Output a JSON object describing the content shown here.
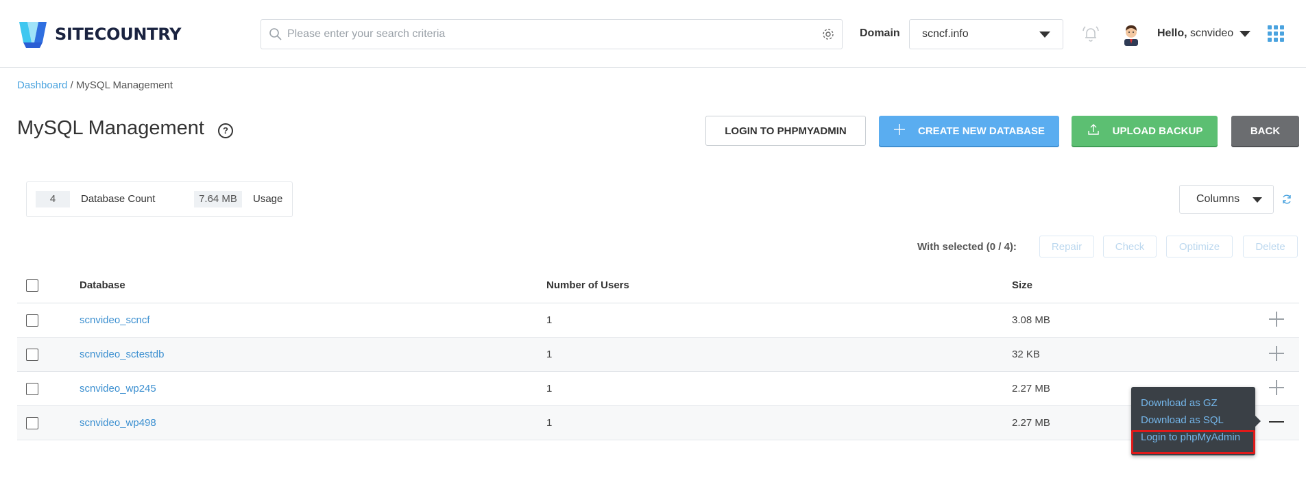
{
  "brand": {
    "name": "SITECOUNTRY",
    "accent": "#4aa3df"
  },
  "search": {
    "placeholder": "Please enter your search criteria"
  },
  "domain": {
    "label": "Domain",
    "selected": "scncf.info"
  },
  "user": {
    "greeting": "Hello,",
    "username": "scnvideo"
  },
  "breadcrumb": {
    "home": "Dashboard",
    "separator": "/",
    "current": "MySQL Management"
  },
  "page": {
    "title": "MySQL Management",
    "help": "?"
  },
  "actions": {
    "phpmyadmin": "LOGIN TO PHPMYADMIN",
    "create": "CREATE NEW DATABASE",
    "upload": "UPLOAD BACKUP",
    "back": "BACK"
  },
  "stats": {
    "count": "4",
    "count_label": "Database Count",
    "usage": "7.64 MB",
    "usage_label": "Usage"
  },
  "columns_button": "Columns",
  "bulk": {
    "label": "With selected (0 / 4):",
    "repair": "Repair",
    "check": "Check",
    "optimize": "Optimize",
    "delete": "Delete"
  },
  "table": {
    "headers": {
      "database": "Database",
      "users": "Number of Users",
      "size": "Size"
    },
    "rows": [
      {
        "database": "scnvideo_scncf",
        "users": "1",
        "size": "3.08 MB"
      },
      {
        "database": "scnvideo_sctestdb",
        "users": "1",
        "size": "32 KB"
      },
      {
        "database": "scnvideo_wp245",
        "users": "1",
        "size": "2.27 MB"
      },
      {
        "database": "scnvideo_wp498",
        "users": "1",
        "size": "2.27 MB"
      }
    ]
  },
  "popover": {
    "items": [
      "Download as GZ",
      "Download as SQL",
      "Login to phpMyAdmin"
    ]
  },
  "colors": {
    "create": "#5aadf0",
    "upload": "#5cbf72",
    "back": "#6b6d70",
    "highlight": "#e01a1a"
  }
}
